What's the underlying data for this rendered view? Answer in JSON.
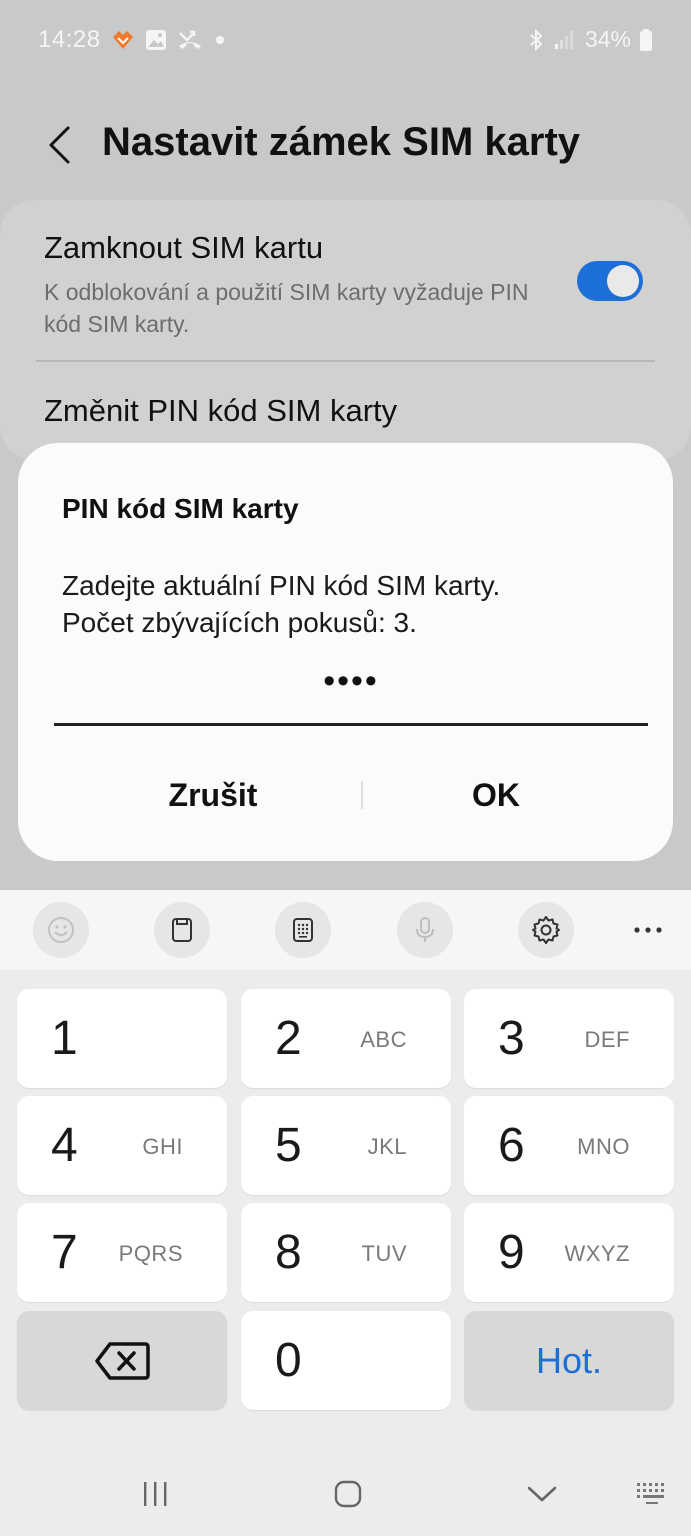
{
  "status_bar": {
    "time": "14:28",
    "battery": "34%",
    "icons": [
      "app-notification-icon",
      "gallery-icon",
      "missed-call-icon",
      "dot-icon",
      "bluetooth-icon",
      "signal-icon",
      "battery-icon"
    ]
  },
  "header": {
    "title": "Nastavit zámek SIM karty",
    "back_icon": "back-arrow-icon"
  },
  "settings": {
    "lock_sim_title": "Zamknout SIM kartu",
    "lock_sim_description": "K odblokování a použití SIM karty vyžaduje PIN kód SIM karty.",
    "lock_sim_enabled": true,
    "change_pin_title": "Změnit PIN kód SIM karty",
    "accent_color": "#1b6fd6"
  },
  "dialog": {
    "title": "PIN kód SIM karty",
    "message_line1": "Zadejte aktuální PIN kód SIM karty.",
    "message_line2": "Počet zbývajících pokusů: 3.",
    "pin_masked": "••••",
    "cancel_label": "Zrušit",
    "ok_label": "OK"
  },
  "keyboard": {
    "toolbar": [
      "emoji-icon",
      "clipboard-icon",
      "keypad-icon",
      "microphone-icon",
      "settings-gear-icon",
      "more-icon"
    ],
    "keys": [
      {
        "digit": "1",
        "letters": ""
      },
      {
        "digit": "2",
        "letters": "ABC"
      },
      {
        "digit": "3",
        "letters": "DEF"
      },
      {
        "digit": "4",
        "letters": "GHI"
      },
      {
        "digit": "5",
        "letters": "JKL"
      },
      {
        "digit": "6",
        "letters": "MNO"
      },
      {
        "digit": "7",
        "letters": "PQRS"
      },
      {
        "digit": "8",
        "letters": "TUV"
      },
      {
        "digit": "9",
        "letters": "WXYZ"
      },
      {
        "digit": "0",
        "letters": ""
      }
    ],
    "backspace_icon": "backspace-icon",
    "done_label": "Hot."
  },
  "nav_bar": {
    "icons": [
      "recent-apps-icon",
      "home-icon",
      "back-chevron-icon",
      "keyboard-switch-icon"
    ]
  }
}
